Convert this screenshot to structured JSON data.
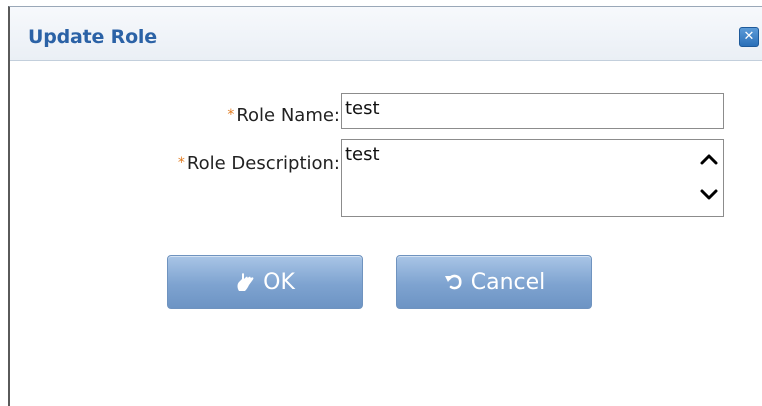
{
  "dialog": {
    "title": "Update Role",
    "close_icon": "close-icon"
  },
  "form": {
    "required_mark": "*",
    "role_name": {
      "label": "Role Name:",
      "value": "test"
    },
    "role_description": {
      "label": "Role Description:",
      "value": "test"
    }
  },
  "buttons": {
    "ok": {
      "label": "OK",
      "icon": "hand-ok-icon"
    },
    "cancel": {
      "label": "Cancel",
      "icon": "undo-arrow-icon"
    }
  }
}
